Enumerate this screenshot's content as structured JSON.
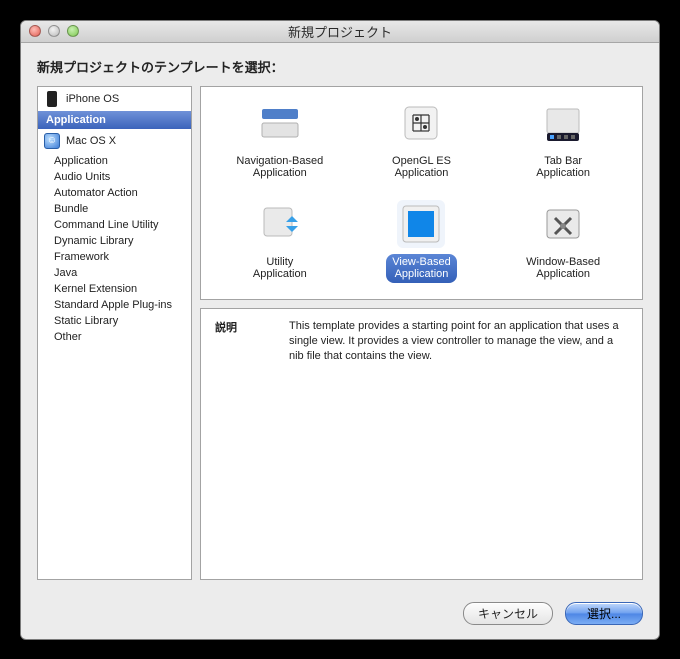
{
  "window": {
    "title": "新規プロジェクト"
  },
  "heading": "新規プロジェクトのテンプレートを選択：",
  "sidebar": {
    "ios_header": "iPhone OS",
    "ios_category": "Application",
    "mac_header": "Mac OS X",
    "mac_items": [
      "Application",
      "Audio Units",
      "Automator Action",
      "Bundle",
      "Command Line Utility",
      "Dynamic Library",
      "Framework",
      "Java",
      "Kernel Extension",
      "Standard Apple Plug-ins",
      "Static Library",
      "Other"
    ]
  },
  "templates": [
    {
      "label": "Navigation-Based\nApplication",
      "icon": "nav"
    },
    {
      "label": "OpenGL ES\nApplication",
      "icon": "opengl"
    },
    {
      "label": "Tab Bar\nApplication",
      "icon": "tabbar"
    },
    {
      "label": "Utility\nApplication",
      "icon": "utility"
    },
    {
      "label": "View-Based\nApplication",
      "icon": "view",
      "selected": true
    },
    {
      "label": "Window-Based\nApplication",
      "icon": "window"
    }
  ],
  "description": {
    "label": "説明",
    "text": "This template provides a starting point for an application that uses a single view. It provides a view controller to manage the view, and a nib file that contains the view."
  },
  "buttons": {
    "cancel": "キャンセル",
    "choose": "選択..."
  }
}
